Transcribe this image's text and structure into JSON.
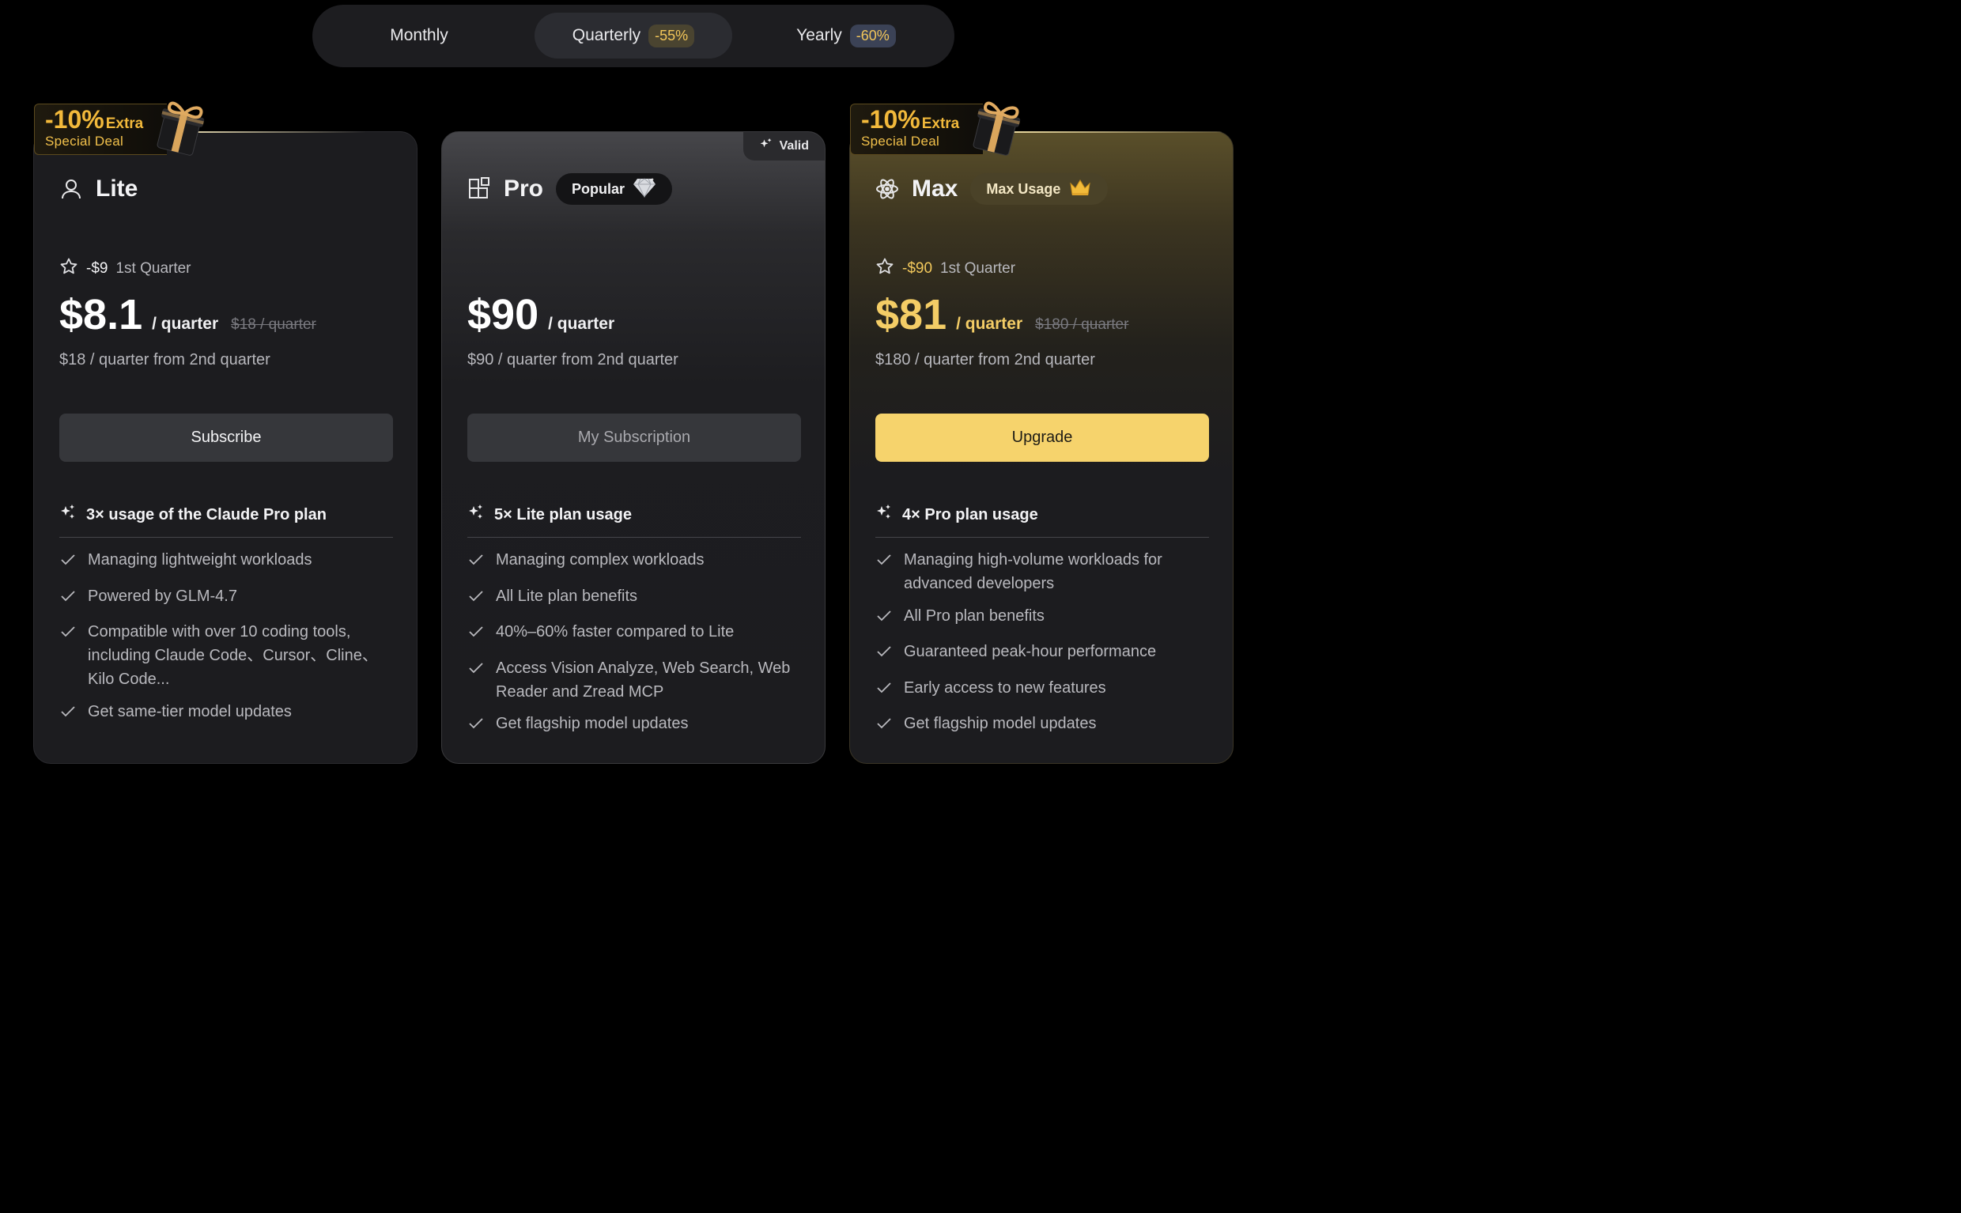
{
  "billing_toggle": {
    "monthly": "Monthly",
    "quarterly": "Quarterly",
    "quarterly_badge": "-55%",
    "yearly": "Yearly",
    "yearly_badge": "-60%"
  },
  "deal_badge": {
    "percent": "-10%",
    "extra": "Extra",
    "label": "Special Deal"
  },
  "plans": [
    {
      "name": "Lite",
      "icon": "user-icon",
      "promo_amount": "-$9",
      "promo_label": "1st Quarter",
      "price": "$8.1",
      "per": "/ quarter",
      "original": "$18 / quarter",
      "renewal": "$18 / quarter from 2nd quarter",
      "cta": "Subscribe",
      "feature_head": "3× usage of the Claude Pro plan",
      "features": [
        "Managing lightweight workloads",
        "Powered by GLM-4.7",
        "Compatible with over 10 coding tools, including Claude Code、Cursor、Cline、Kilo Code...",
        "Get same-tier model updates"
      ]
    },
    {
      "name": "Pro",
      "icon": "grid-blocks-icon",
      "pill": "Popular",
      "valid_tag": "Valid",
      "price": "$90",
      "per": "/ quarter",
      "renewal": "$90 / quarter from 2nd quarter",
      "cta": "My Subscription",
      "feature_head": "5× Lite plan usage",
      "features": [
        "Managing complex workloads",
        "All Lite plan benefits",
        "40%–60% faster compared to Lite",
        "Access Vision Analyze, Web Search, Web Reader and Zread MCP",
        "Get flagship model updates"
      ]
    },
    {
      "name": "Max",
      "icon": "atom-icon",
      "pill": "Max Usage",
      "promo_amount": "-$90",
      "promo_label": "1st Quarter",
      "price": "$81",
      "per": "/ quarter",
      "original": "$180 / quarter",
      "renewal": "$180 / quarter from 2nd quarter",
      "cta": "Upgrade",
      "feature_head": "4× Pro plan usage",
      "features": [
        "Managing high-volume workloads for advanced developers",
        "All Pro plan benefits",
        "Guaranteed peak-hour performance",
        "Early access to new features",
        "Get flagship model updates"
      ]
    }
  ],
  "colors": {
    "accent_gold": "#f6d36c",
    "background": "#000000",
    "card": "#1c1c1f"
  }
}
